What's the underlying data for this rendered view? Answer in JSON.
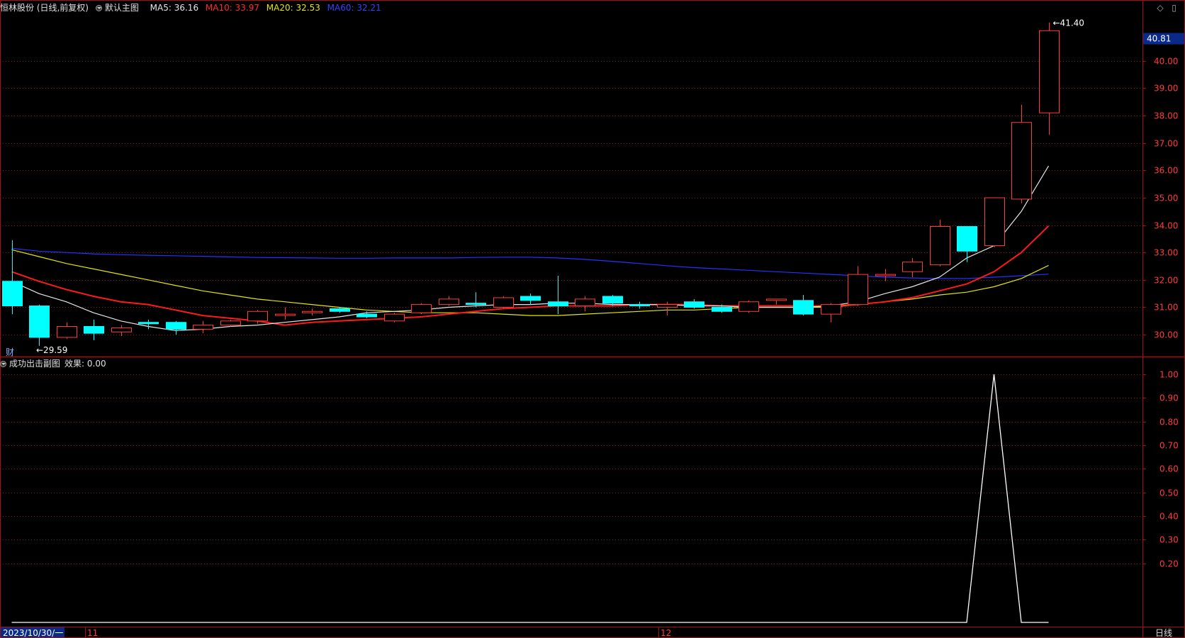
{
  "header": {
    "stock_title": "恒林股份 (日线,前复权)",
    "main_chart_name": "默认主图",
    "ma5_label": "MA5: 36.16",
    "ma10_label": "MA10: 33.97",
    "ma20_label": "MA20: 32.53",
    "ma60_label": "MA60: 32.21"
  },
  "top_right_icons": "◇ ▯",
  "finance_badge": "财",
  "sub_header": {
    "title": "成功出击副图",
    "effect_label": "效果: 0.00"
  },
  "footer": {
    "date_box": "2023/10/30/一",
    "month_labels": [
      "11",
      "12"
    ],
    "period_label": "日线"
  },
  "colors": {
    "up": "#ff3b3b",
    "down": "#00ffff",
    "ma5": "#e6e6e6",
    "ma10": "#ff1a1a",
    "ma20": "#e6e600",
    "ma60": "#2233ff",
    "grid": "#8b1a1a",
    "axis": "#a01010"
  },
  "chart_data": [
    {
      "type": "candlestick",
      "title": "恒林股份 (日线,前复权)",
      "ylim": [
        29.2,
        41.6
      ],
      "y_ticks": [
        30.0,
        31.0,
        32.0,
        33.0,
        34.0,
        35.0,
        36.0,
        37.0,
        38.0,
        39.0,
        40.0
      ],
      "current_price_label": "40.81",
      "annotations": {
        "high": "41.40",
        "low": "29.59"
      },
      "first_date": "2023/10/30",
      "month_starts": [
        {
          "label": "11",
          "index": 3
        },
        {
          "label": "12",
          "index": 24
        }
      ],
      "candles": [
        {
          "o": 31.95,
          "h": 33.45,
          "l": 30.75,
          "c": 31.05
        },
        {
          "o": 31.05,
          "h": 31.1,
          "l": 29.59,
          "c": 29.9
        },
        {
          "o": 29.9,
          "h": 30.45,
          "l": 29.85,
          "c": 30.3
        },
        {
          "o": 30.3,
          "h": 30.55,
          "l": 29.8,
          "c": 30.05
        },
        {
          "o": 30.1,
          "h": 30.35,
          "l": 29.95,
          "c": 30.25
        },
        {
          "o": 30.45,
          "h": 30.55,
          "l": 30.2,
          "c": 30.4
        },
        {
          "o": 30.45,
          "h": 30.5,
          "l": 30.0,
          "c": 30.2
        },
        {
          "o": 30.2,
          "h": 30.5,
          "l": 30.05,
          "c": 30.35
        },
        {
          "o": 30.35,
          "h": 30.55,
          "l": 30.3,
          "c": 30.5
        },
        {
          "o": 30.5,
          "h": 30.9,
          "l": 30.4,
          "c": 30.85
        },
        {
          "o": 30.7,
          "h": 31.0,
          "l": 30.55,
          "c": 30.75
        },
        {
          "o": 30.8,
          "h": 30.95,
          "l": 30.7,
          "c": 30.85
        },
        {
          "o": 30.95,
          "h": 31.0,
          "l": 30.8,
          "c": 30.85
        },
        {
          "o": 30.75,
          "h": 30.85,
          "l": 30.6,
          "c": 30.65
        },
        {
          "o": 30.5,
          "h": 30.8,
          "l": 30.45,
          "c": 30.75
        },
        {
          "o": 30.8,
          "h": 31.15,
          "l": 30.75,
          "c": 31.1
        },
        {
          "o": 31.1,
          "h": 31.4,
          "l": 31.05,
          "c": 31.3
        },
        {
          "o": 31.15,
          "h": 31.55,
          "l": 31.0,
          "c": 31.1
        },
        {
          "o": 31.0,
          "h": 31.4,
          "l": 30.95,
          "c": 31.35
        },
        {
          "o": 31.4,
          "h": 31.5,
          "l": 31.1,
          "c": 31.25
        },
        {
          "o": 31.2,
          "h": 32.15,
          "l": 30.75,
          "c": 31.05
        },
        {
          "o": 31.05,
          "h": 31.4,
          "l": 30.85,
          "c": 31.3
        },
        {
          "o": 31.4,
          "h": 31.45,
          "l": 31.05,
          "c": 31.15
        },
        {
          "o": 31.1,
          "h": 31.2,
          "l": 30.95,
          "c": 31.05
        },
        {
          "o": 31.0,
          "h": 31.2,
          "l": 30.7,
          "c": 31.1
        },
        {
          "o": 31.2,
          "h": 31.3,
          "l": 30.95,
          "c": 31.0
        },
        {
          "o": 31.0,
          "h": 31.1,
          "l": 30.8,
          "c": 30.85
        },
        {
          "o": 30.85,
          "h": 31.25,
          "l": 30.8,
          "c": 31.2
        },
        {
          "o": 31.25,
          "h": 31.3,
          "l": 31.1,
          "c": 31.3
        },
        {
          "o": 31.25,
          "h": 31.45,
          "l": 30.7,
          "c": 30.75
        },
        {
          "o": 30.75,
          "h": 31.15,
          "l": 30.45,
          "c": 31.1
        },
        {
          "o": 31.1,
          "h": 32.5,
          "l": 31.05,
          "c": 32.2
        },
        {
          "o": 32.15,
          "h": 32.4,
          "l": 31.95,
          "c": 32.2
        },
        {
          "o": 32.3,
          "h": 32.8,
          "l": 32.1,
          "c": 32.65
        },
        {
          "o": 32.55,
          "h": 34.2,
          "l": 32.5,
          "c": 33.95
        },
        {
          "o": 33.95,
          "h": 33.95,
          "l": 32.65,
          "c": 33.05
        },
        {
          "o": 33.25,
          "h": 35.0,
          "l": 33.2,
          "c": 35.0
        },
        {
          "o": 34.95,
          "h": 38.4,
          "l": 34.8,
          "c": 37.75
        },
        {
          "o": 38.1,
          "h": 41.4,
          "l": 37.3,
          "c": 41.1
        }
      ],
      "series": [
        {
          "name": "MA5",
          "values": [
            31.95,
            31.5,
            31.2,
            30.8,
            30.5,
            30.3,
            30.15,
            30.2,
            30.3,
            30.35,
            30.45,
            30.55,
            30.65,
            30.8,
            30.85,
            30.9,
            31.0,
            31.05,
            31.1,
            31.1,
            31.15,
            31.15,
            31.1,
            31.1,
            31.1,
            31.05,
            31.05,
            31.0,
            31.0,
            31.0,
            31.05,
            31.2,
            31.5,
            31.75,
            32.1,
            32.8,
            33.25,
            34.5,
            36.16
          ]
        },
        {
          "name": "MA10",
          "values": [
            32.3,
            31.95,
            31.65,
            31.4,
            31.2,
            31.1,
            30.9,
            30.7,
            30.6,
            30.5,
            30.35,
            30.45,
            30.5,
            30.55,
            30.6,
            30.65,
            30.75,
            30.85,
            30.95,
            31.0,
            31.05,
            31.05,
            31.05,
            31.1,
            31.1,
            31.1,
            31.05,
            31.05,
            31.05,
            31.05,
            31.05,
            31.1,
            31.2,
            31.35,
            31.6,
            31.85,
            32.3,
            33.0,
            33.97
          ]
        },
        {
          "name": "MA20",
          "values": [
            33.1,
            32.85,
            32.6,
            32.4,
            32.2,
            32.0,
            31.8,
            31.6,
            31.45,
            31.3,
            31.2,
            31.1,
            31.0,
            30.9,
            30.85,
            30.8,
            30.8,
            30.8,
            30.75,
            30.7,
            30.7,
            30.75,
            30.8,
            30.85,
            30.9,
            30.9,
            30.95,
            31.0,
            31.0,
            31.0,
            31.0,
            31.1,
            31.2,
            31.3,
            31.45,
            31.55,
            31.75,
            32.05,
            32.53
          ]
        },
        {
          "name": "MA60",
          "values": [
            33.15,
            33.05,
            33.0,
            32.95,
            32.92,
            32.9,
            32.88,
            32.86,
            32.84,
            32.82,
            32.81,
            32.8,
            32.79,
            32.79,
            32.8,
            32.8,
            32.8,
            32.82,
            32.83,
            32.83,
            32.8,
            32.75,
            32.68,
            32.6,
            32.52,
            32.45,
            32.4,
            32.35,
            32.3,
            32.25,
            32.2,
            32.15,
            32.1,
            32.07,
            32.05,
            32.05,
            32.1,
            32.15,
            32.21
          ]
        }
      ]
    },
    {
      "type": "line",
      "title": "成功出击副图",
      "ylim": [
        0,
        1.0
      ],
      "y_ticks": [
        0.2,
        0.3,
        0.4,
        0.5,
        0.6,
        0.7,
        0.8,
        0.9,
        1.0
      ],
      "series": [
        {
          "name": "效果",
          "values": [
            0,
            0,
            0,
            0,
            0,
            0,
            0,
            0,
            0,
            0,
            0,
            0,
            0,
            0,
            0,
            0,
            0,
            0,
            0,
            0,
            0,
            0,
            0,
            0,
            0,
            0,
            0,
            0,
            0,
            0,
            0,
            0,
            0,
            0,
            0,
            0,
            1,
            0,
            0
          ]
        }
      ]
    }
  ]
}
